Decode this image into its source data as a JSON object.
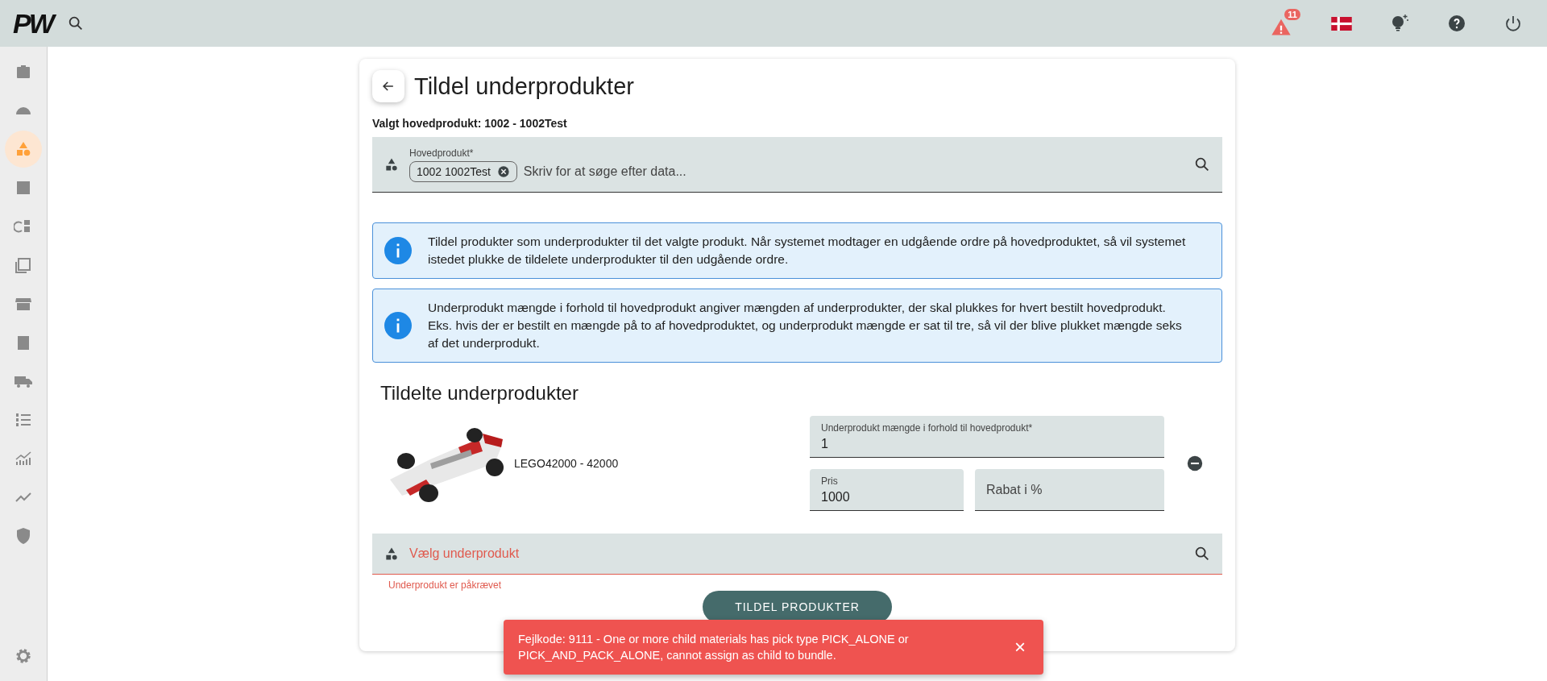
{
  "topbar": {
    "logo": "PW",
    "notification_count": "11"
  },
  "sidebar": {
    "items": [
      {
        "selected": false
      },
      {
        "selected": false
      },
      {
        "selected": true
      },
      {
        "selected": false
      },
      {
        "selected": false
      },
      {
        "selected": false
      },
      {
        "selected": false
      },
      {
        "selected": false
      },
      {
        "selected": false
      },
      {
        "selected": false
      },
      {
        "selected": false
      },
      {
        "selected": false
      },
      {
        "selected": false
      }
    ]
  },
  "page": {
    "title": "Tildel underprodukter",
    "selected_main": "Valgt hovedprodukt: 1002 - 1002Test",
    "main_field": {
      "label": "Hovedprodukt*",
      "chip": "1002 1002Test",
      "placeholder": "Skriv for at søge efter data..."
    },
    "info": [
      "Tildel produkter som underprodukter til det valgte produkt. Når systemet modtager en udgående ordre på hovedproduktet, så vil systemet istedet plukke de tildelete underprodukter til den udgående ordre.",
      "Underprodukt mængde i forhold til hovedprodukt angiver mængden af underprodukter, der skal plukkes for hvert bestilt hovedprodukt. Eks. hvis der er bestilt en mængde på to af hovedproduktet, og underprodukt mængde er sat til tre, så vil der blive plukket mængde seks af det underprodukt."
    ],
    "assigned_heading": "Tildelte underprodukter",
    "assigned": [
      {
        "kind": "picture",
        "name": "LEGO42000 - 42000",
        "quantity_label": "Underprodukt mængde i forhold til hovedprodukt*",
        "quantity": "1",
        "price_label": "Pris",
        "price": "1000",
        "discount_placeholder": "Rabat i %"
      }
    ],
    "child_field": {
      "placeholder": "Vælg underprodukt",
      "error": "Underprodukt er påkrævet"
    },
    "submit_button": "TILDEL PRODUKTER"
  },
  "toast": {
    "message": "Fejlkode: 9111 - One or more child materials has pick type PICK_ALONE or PICK_AND_PACK_ALONE, cannot assign as child to bundle.",
    "close": "×"
  }
}
